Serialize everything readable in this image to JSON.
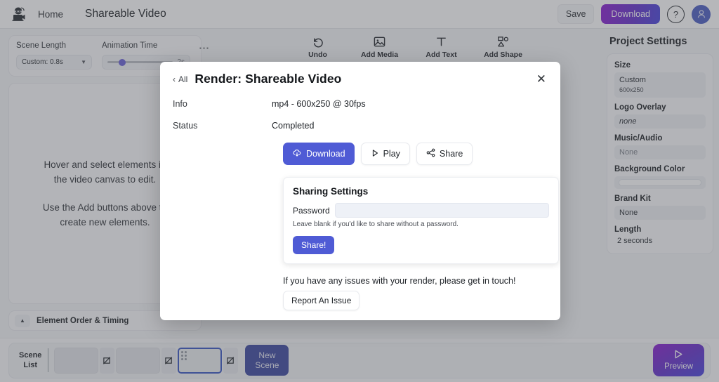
{
  "header": {
    "logo_icon": "ninja-video-logo",
    "home_label": "Home",
    "project_title": "Shareable Video",
    "save_label": "Save",
    "download_label": "Download",
    "help_icon": "question-mark-icon",
    "avatar_icon": "user-avatar-icon",
    "download_gradient_from": "#8b1fd0",
    "download_gradient_to": "#4a46dd"
  },
  "left_panel": {
    "scene_length_label": "Scene Length",
    "scene_length_value": "Custom: 0.8s",
    "animation_time_label": "Animation Time",
    "animation_time_value": "2s",
    "animation_slider_percent": 22,
    "kebab_icon": "more-vertical-icon",
    "canvas_line1": "Hover and select elements in",
    "canvas_line2": "the video canvas to edit.",
    "canvas_line3": "Use the Add buttons above to",
    "canvas_line4": "create new elements.",
    "element_order_label": "Element Order & Timing",
    "element_order_chevron": "chevron-up-icon"
  },
  "toolbar": {
    "items": [
      {
        "label": "Undo",
        "icon": "undo-arrow-icon"
      },
      {
        "label": "Add Media",
        "icon": "image-icon"
      },
      {
        "label": "Add Text",
        "icon": "text-t-icon"
      },
      {
        "label": "Add Shape",
        "icon": "shapes-icon"
      }
    ]
  },
  "project_settings": {
    "title": "Project Settings",
    "size_label": "Size",
    "size_value": "Custom",
    "size_sub": "600x250",
    "logo_overlay_label": "Logo Overlay",
    "logo_overlay_value": "none",
    "music_audio_label": "Music/Audio",
    "music_audio_value": "None",
    "background_color_label": "Background Color",
    "background_color_value": "#ffffff",
    "brand_kit_label": "Brand Kit",
    "brand_kit_value": "None",
    "length_label": "Length",
    "length_value": "2 seconds"
  },
  "scene_bar": {
    "list_label_line1": "Scene",
    "list_label_line2": "List",
    "scenes": [
      {
        "selected": false,
        "handle": false
      },
      {
        "selected": false,
        "handle": false
      },
      {
        "selected": true,
        "handle": true
      }
    ],
    "transition_icon": "transition-icon",
    "new_scene_line1": "New",
    "new_scene_line2": "Scene",
    "preview_label": "Preview",
    "preview_icon": "play-triangle-icon",
    "selected_border_color": "#3b57c4"
  },
  "modal": {
    "back_label": "All",
    "back_icon": "chevron-left-icon",
    "title": "Render: Shareable Video",
    "close_icon": "close-x-icon",
    "info_key": "Info",
    "info_value": "mp4 - 600x250 @ 30fps",
    "status_key": "Status",
    "status_value": "Completed",
    "download_label": "Download",
    "download_icon": "cloud-download-icon",
    "play_label": "Play",
    "play_icon": "play-triangle-icon",
    "share_label": "Share",
    "share_icon": "share-nodes-icon",
    "sharing": {
      "title": "Sharing Settings",
      "password_label": "Password",
      "password_value": "",
      "password_placeholder": "",
      "hint": "Leave blank if you'd like to share without a password.",
      "share_button_label": "Share!"
    },
    "footer_note": "If you have any issues with your render, please get in touch!",
    "report_label": "Report An Issue",
    "accent_color": "#4f5bd5"
  }
}
